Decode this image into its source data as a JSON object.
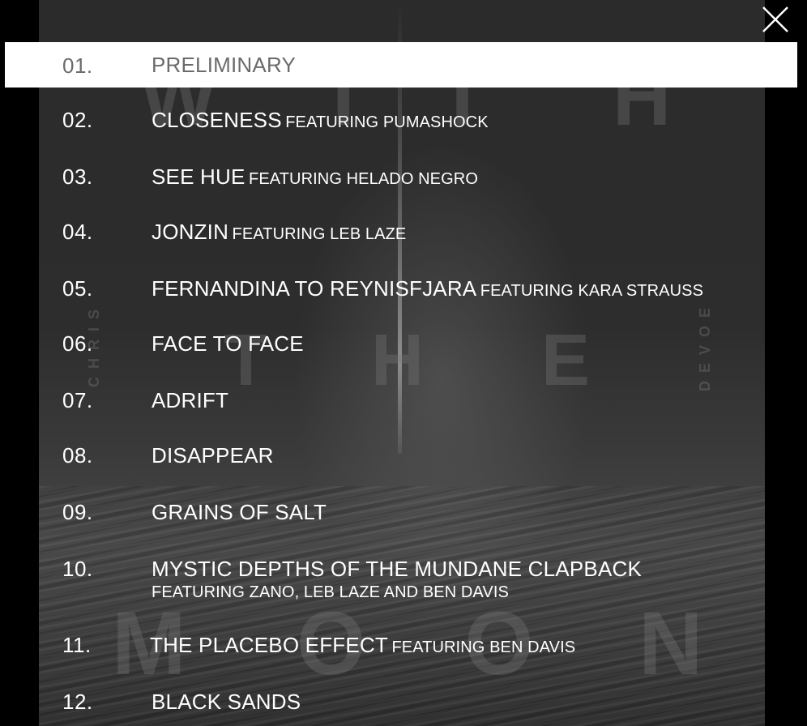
{
  "window": {
    "close_icon": "close-icon"
  },
  "album_art": {
    "top_letters": [
      "W",
      "I",
      "T",
      "H"
    ],
    "middle_letters": [
      "T",
      "H",
      "E"
    ],
    "bottom_letters": [
      "M",
      "O",
      "O",
      "N"
    ],
    "left_vertical_text": "CHRIS",
    "right_vertical_text": "DEVOE"
  },
  "tracks": [
    {
      "num": "01.",
      "name": "PRELIMINARY",
      "feat": "",
      "active": true
    },
    {
      "num": "02.",
      "name": "CLOSENESS",
      "feat": "FEATURING PUMASHOCK"
    },
    {
      "num": "03.",
      "name": "SEE HUE",
      "feat": "FEATURING HELADO NEGRO"
    },
    {
      "num": "04.",
      "name": "JONZIN",
      "feat": "FEATURING LEB LAZE"
    },
    {
      "num": "05.",
      "name": "FERNANDINA TO REYNISFJARA",
      "feat": "FEATURING KARA STRAUSS"
    },
    {
      "num": "06.",
      "name": "FACE TO FACE",
      "feat": ""
    },
    {
      "num": "07.",
      "name": "ADRIFT",
      "feat": ""
    },
    {
      "num": "08.",
      "name": "DISAPPEAR",
      "feat": ""
    },
    {
      "num": "09.",
      "name": "GRAINS OF SALT",
      "feat": ""
    },
    {
      "num": "10.",
      "name": "MYSTIC DEPTHS OF THE MUNDANE CLAPBACK",
      "feat": "FEATURING ZANO, LEB LAZE AND BEN DAVIS"
    },
    {
      "num": "11.",
      "name": "THE PLACEBO EFFECT",
      "feat": "FEATURING BEN DAVIS"
    },
    {
      "num": "12.",
      "name": "BLACK SANDS",
      "feat": ""
    }
  ]
}
